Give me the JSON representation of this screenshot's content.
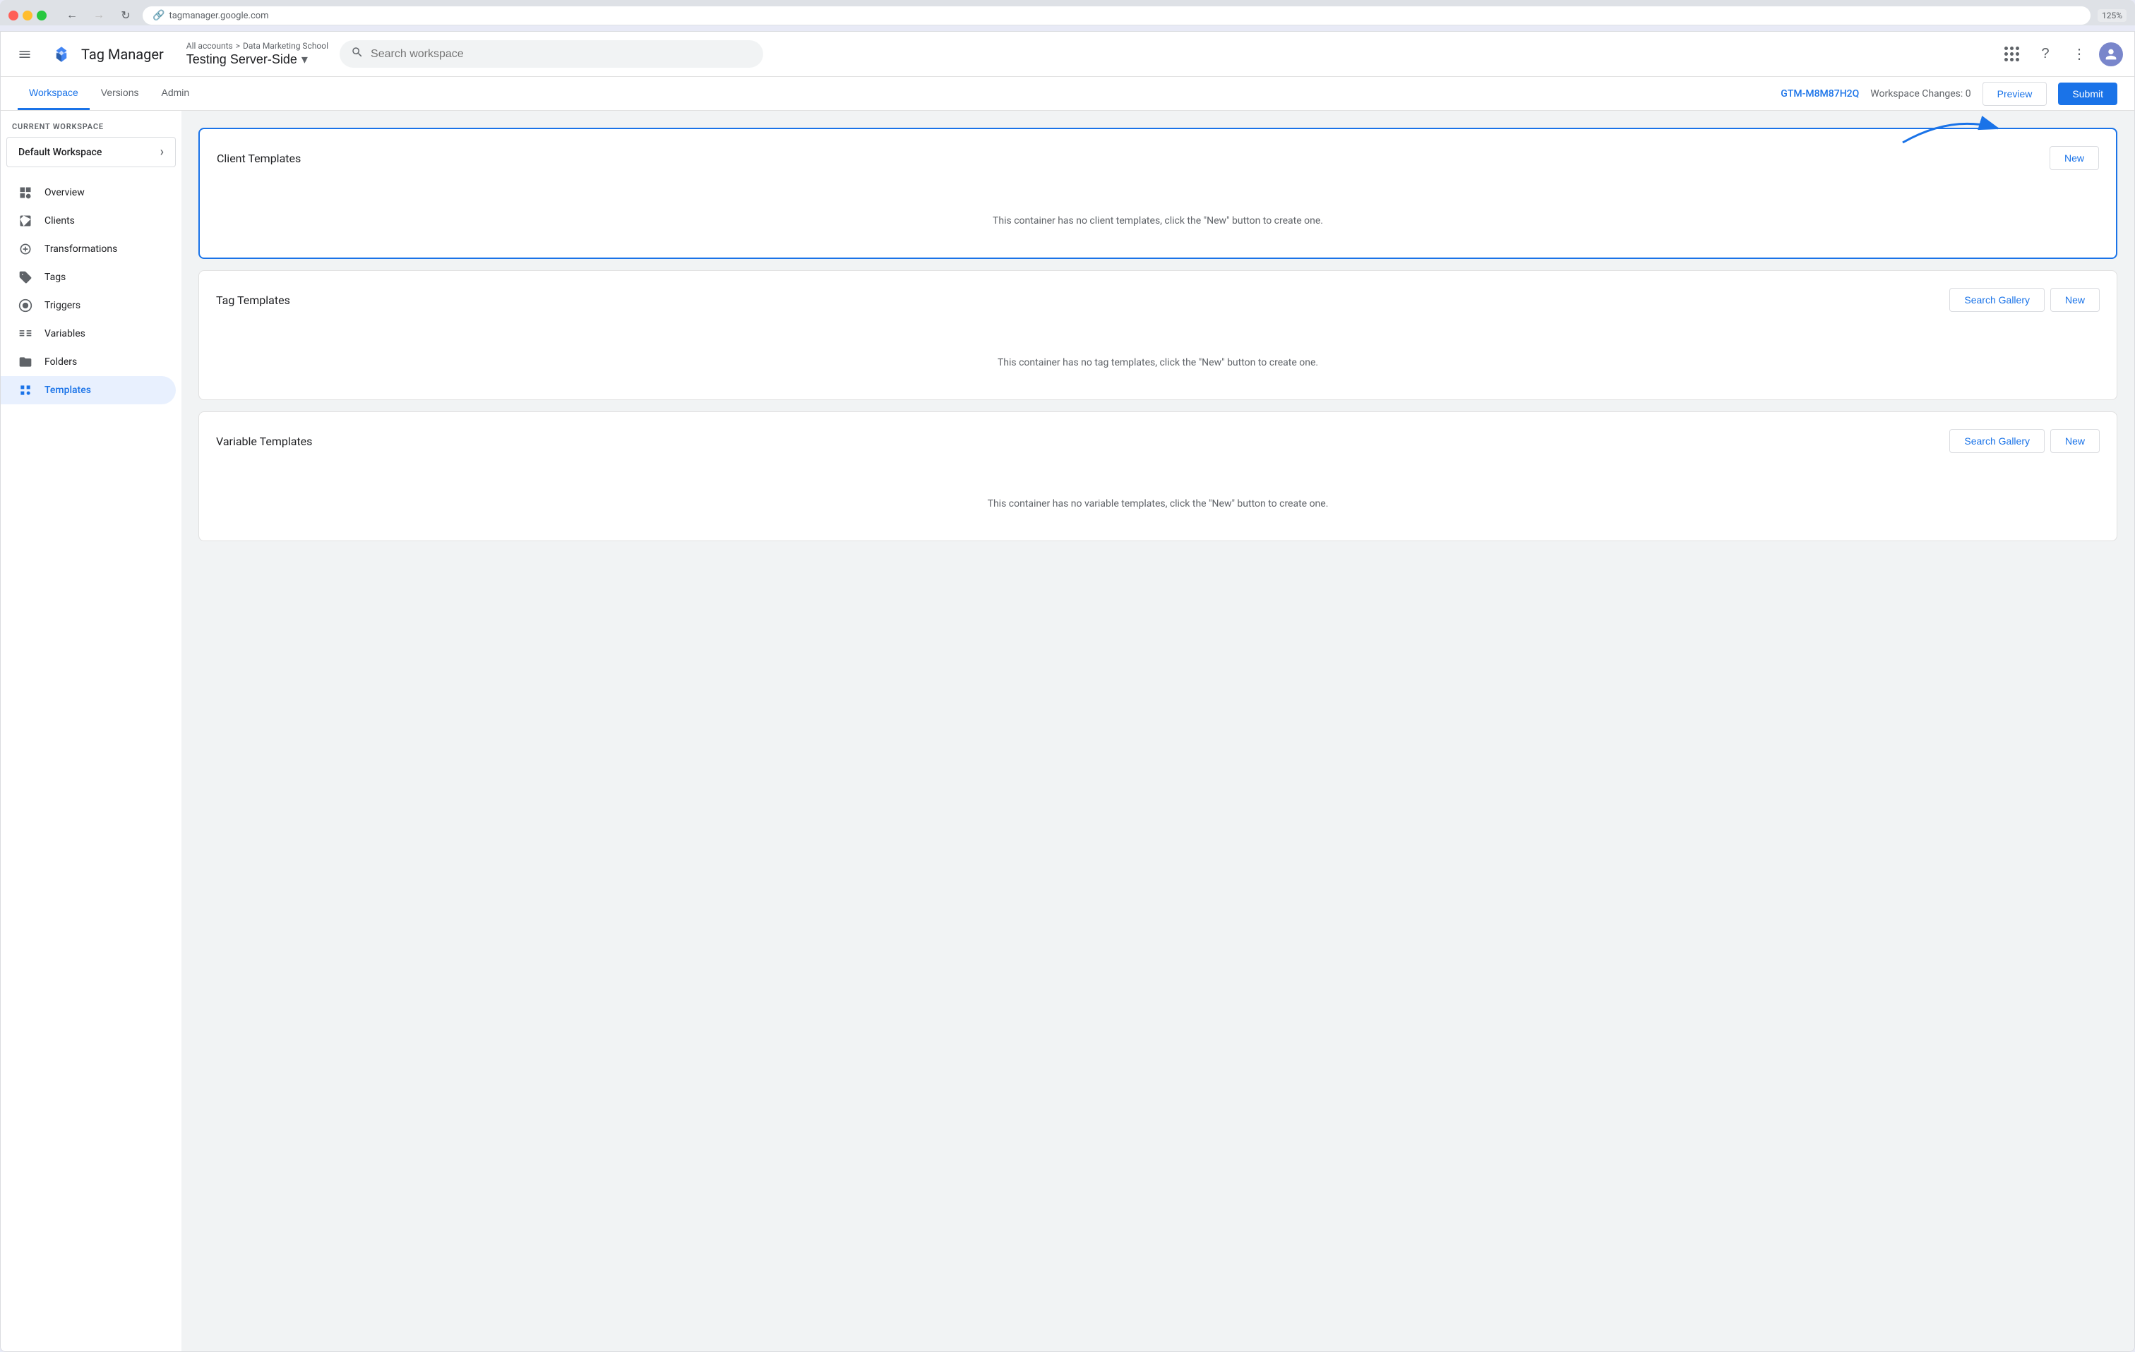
{
  "browser": {
    "url": "tagmanager.google.com",
    "zoom": "125%"
  },
  "app": {
    "title": "Tag Manager",
    "search_placeholder": "Search workspace"
  },
  "breadcrumb": {
    "all_accounts": "All accounts",
    "separator": ">",
    "account": "Data Marketing School"
  },
  "container": {
    "name": "Testing Server-Side"
  },
  "nav": {
    "tabs": [
      {
        "label": "Workspace",
        "active": true
      },
      {
        "label": "Versions",
        "active": false
      },
      {
        "label": "Admin",
        "active": false
      }
    ],
    "gtm_id": "GTM-M8M87H2Q",
    "workspace_changes": "Workspace Changes: 0",
    "preview_label": "Preview",
    "submit_label": "Submit"
  },
  "sidebar": {
    "current_workspace_label": "CURRENT WORKSPACE",
    "workspace_name": "Default Workspace",
    "items": [
      {
        "label": "Overview",
        "icon": "overview"
      },
      {
        "label": "Clients",
        "icon": "clients"
      },
      {
        "label": "Transformations",
        "icon": "transformations"
      },
      {
        "label": "Tags",
        "icon": "tags"
      },
      {
        "label": "Triggers",
        "icon": "triggers"
      },
      {
        "label": "Variables",
        "icon": "variables"
      },
      {
        "label": "Folders",
        "icon": "folders"
      },
      {
        "label": "Templates",
        "icon": "templates",
        "active": true
      }
    ]
  },
  "sections": {
    "client_templates": {
      "title": "Client Templates",
      "empty_message": "This container has no client templates, click the \"New\" button to create one.",
      "new_label": "New",
      "highlighted": true
    },
    "tag_templates": {
      "title": "Tag Templates",
      "empty_message": "This container has no tag templates, click the \"New\" button to create one.",
      "search_gallery_label": "Search Gallery",
      "new_label": "New",
      "highlighted": false
    },
    "variable_templates": {
      "title": "Variable Templates",
      "empty_message": "This container has no variable templates, click the \"New\" button to create one.",
      "search_gallery_label": "Search Gallery",
      "new_label": "New",
      "highlighted": false
    }
  }
}
